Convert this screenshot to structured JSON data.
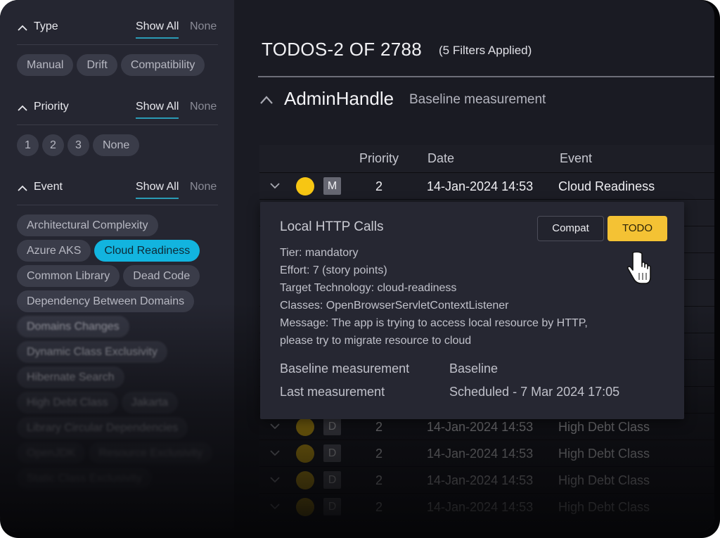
{
  "sidebar": {
    "sections": [
      {
        "title": "Type",
        "show_all": "Show All",
        "none": "None",
        "chips": [
          "Manual",
          "Drift",
          "Compatibility"
        ]
      },
      {
        "title": "Priority",
        "show_all": "Show All",
        "none": "None",
        "chips": [
          "1",
          "2",
          "3",
          "None"
        ]
      },
      {
        "title": "Event",
        "show_all": "Show All",
        "none": "None",
        "chips": [
          "Architectural Complexity",
          "Azure AKS",
          "Cloud Readiness",
          "Common Library",
          "Dead Code",
          "Dependency Between Domains",
          "Domains Changes",
          "Dynamic Class Exclusivity",
          "Hibernate Search",
          "High Debt Class",
          "Jakarta",
          "Library Circular Dependencies",
          "OpenJDK",
          "Resource Exclusivity",
          "Static Class Exclusivity"
        ],
        "active_chip": "Cloud Readiness"
      }
    ]
  },
  "main": {
    "title": "TODOS-2 OF 2788",
    "filters_applied": "(5 Filters Applied)",
    "group": {
      "title": "AdminHandle",
      "subtitle": "Baseline measurement"
    },
    "table": {
      "columns": [
        "Priority",
        "Date",
        "Event"
      ],
      "rows": [
        {
          "type_badge": "M",
          "priority": "2",
          "date": "14-Jan-2024 14:53",
          "event": "Cloud Readiness"
        },
        {
          "type_badge": "D",
          "priority": "2",
          "date": "14-Jan-2024 14:53",
          "event": "High Debt Class"
        },
        {
          "type_badge": "D",
          "priority": "2",
          "date": "14-Jan-2024 14:53",
          "event": "High Debt Class"
        },
        {
          "type_badge": "D",
          "priority": "2",
          "date": "14-Jan-2024 14:53",
          "event": "High Debt Class"
        },
        {
          "type_badge": "D",
          "priority": "2",
          "date": "14-Jan-2024 14:53",
          "event": "High Debt Class"
        }
      ]
    },
    "popup": {
      "title": "Local HTTP Calls",
      "lines": [
        "Tier: mandatory",
        "Effort: 7 (story points)",
        "Target Technology: cloud-readiness",
        "Classes: OpenBrowserServletContextListener",
        "Message: The app is trying to access local resource by HTTP,",
        "please try to migrate resource to cloud"
      ],
      "buttons": {
        "compat": "Compat",
        "todo": "TODO"
      },
      "details": [
        {
          "key": "Baseline measurement",
          "value": "Baseline"
        },
        {
          "key": "Last measurement",
          "value": "Scheduled - 7 Mar 2024 17:05"
        }
      ]
    }
  },
  "colors": {
    "accent": "#12b4df",
    "todo_button": "#f4c234",
    "priority_dot": "#f7c613",
    "background": "#1a1b23",
    "sidebar": "#252631"
  }
}
